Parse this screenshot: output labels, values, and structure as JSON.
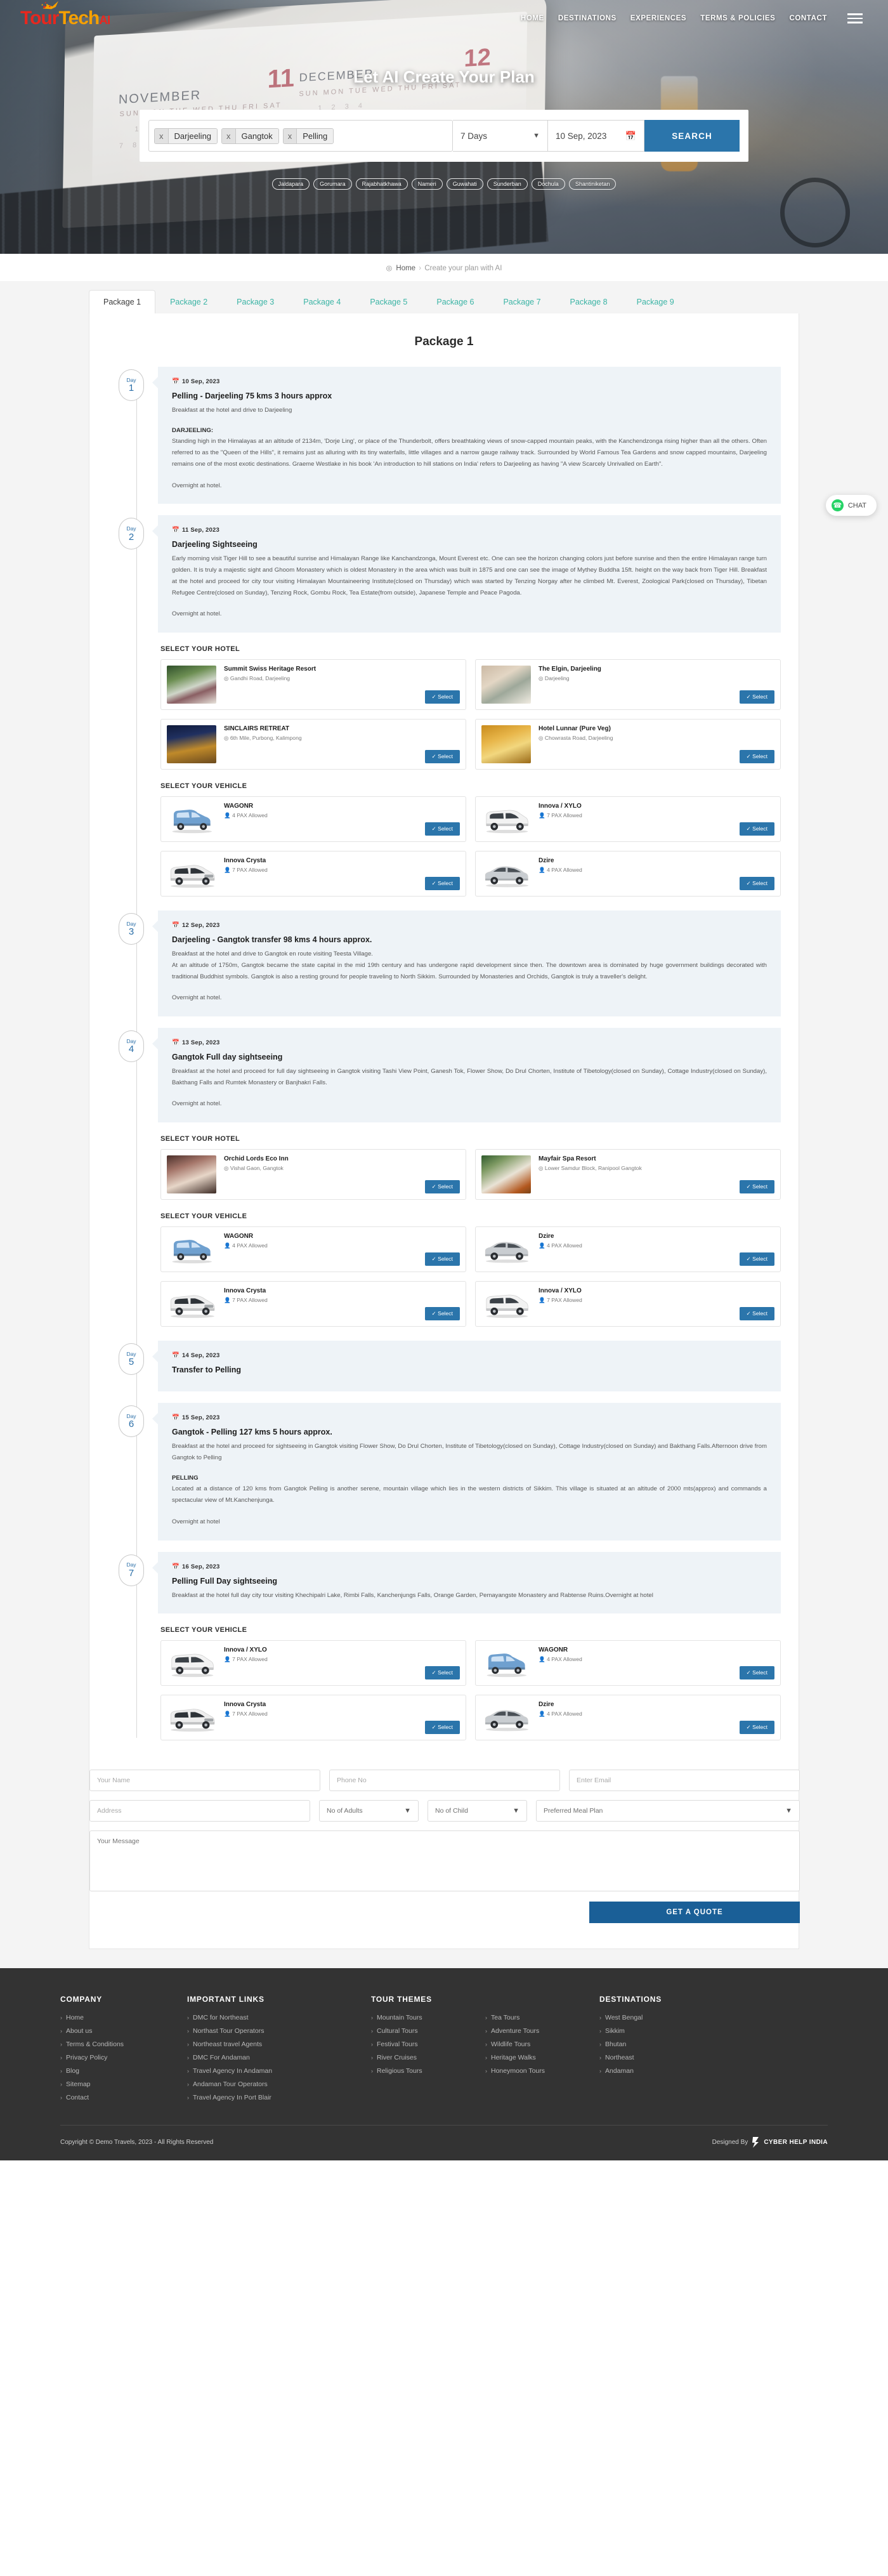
{
  "brand": {
    "name_part1": "T",
    "name_part2": "our",
    "name_part3": "Tech",
    "name_suffix": "AI"
  },
  "nav": {
    "items": [
      {
        "label": "HOME"
      },
      {
        "label": "DESTINATIONS"
      },
      {
        "label": "EXPERIENCES"
      },
      {
        "label": "TERMS & POLICIES"
      },
      {
        "label": "CONTACT"
      }
    ]
  },
  "hero": {
    "title": "Let AI Create Your Plan",
    "calendar": {
      "month_left": "NOVEMBER",
      "num_left": "11",
      "month_right": "DECEMBER",
      "num_right": "12"
    }
  },
  "search": {
    "destinations": [
      {
        "remove": "x",
        "label": "Darjeeling"
      },
      {
        "remove": "x",
        "label": "Gangtok"
      },
      {
        "remove": "x",
        "label": "Pelling"
      }
    ],
    "duration": "7 Days",
    "date": "10 Sep, 2023",
    "calendar_icon": "Ὄ5",
    "button": "SEARCH"
  },
  "tags": [
    "Jaldapara",
    "Gorumara",
    "Rajabhatkhawa",
    "Nameri",
    "Guwahati",
    "Sunderban",
    "Dochula",
    "Shantiniketan"
  ],
  "breadcrumb": {
    "home": "Home",
    "separator": "›",
    "current": "Create your plan with AI"
  },
  "tabs": [
    {
      "label": "Package 1",
      "active": true
    },
    {
      "label": "Package 2",
      "active": false
    },
    {
      "label": "Package 3",
      "active": false
    },
    {
      "label": "Package 4",
      "active": false
    },
    {
      "label": "Package 5",
      "active": false
    },
    {
      "label": "Package 6",
      "active": false
    },
    {
      "label": "Package 7",
      "active": false
    },
    {
      "label": "Package 8",
      "active": false
    },
    {
      "label": "Package 9",
      "active": false
    }
  ],
  "package_title": "Package 1",
  "section_labels": {
    "hotel": "SELECT YOUR HOTEL",
    "vehicle": "SELECT YOUR VEHICLE",
    "select": "Select",
    "check": "✓"
  },
  "days": [
    {
      "day_word": "Day",
      "day_num": "1",
      "date": "10 Sep, 2023",
      "heading": "Pelling - Darjeeling 75 kms 3 hours approx",
      "line1": "Breakfast at the hotel and drive to Darjeeling",
      "sub_heading": "DARJEELING:",
      "body": "Standing high in the Himalayas at an altitude of 2134m, 'Dorje Ling', or place of the Thunderbolt, offers breathtaking views of snow-capped mountain peaks, with the Kanchendzonga rising higher than all the others. Often referred to as the \"Queen of the Hills\", it remains just as alluring with its tiny waterfalls, little villages and a narrow gauge railway track. Surrounded by World Famous Tea Gardens and snow capped mountains, Darjeeling remains one of the most exotic destinations. Graeme Westlake in his book 'An introduction to hill stations on India' refers to Darjeeling as having \"A view Scarcely Unrivalled on Earth\".",
      "footer_line": "Overnight at hotel.",
      "hotels": [],
      "vehicles": []
    },
    {
      "day_word": "Day",
      "day_num": "2",
      "date": "11 Sep, 2023",
      "heading": "Darjeeling Sightseeing",
      "line1": "",
      "sub_heading": "",
      "body": "Early morning visit Tiger Hill to see a beautiful sunrise and Himalayan Range like Kanchandzonga, Mount Everest etc. One can see the horizon changing colors just before sunrise and then the entire Himalayan range turn golden. It is truly a majestic sight and Ghoom Monastery which is oldest Monastery in the area which was built in 1875 and one can see the image of Mythey Buddha 15ft. height on the way back from Tiger Hill. Breakfast at the hotel and proceed for city tour visiting Himalayan Mountaineering Institute(closed on Thursday) which was started by Tenzing Norgay after he climbed Mt. Everest, Zoological Park(closed on Thursday), Tibetan Refugee Centre(closed on Sunday), Tenzing Rock, Gombu Rock, Tea Estate(from outside), Japanese Temple and Peace Pagoda.",
      "footer_line": "Overnight at hotel.",
      "hotels": [
        {
          "name": "Summit Swiss Heritage Resort",
          "location": "Gandhi Road, Darjeeling",
          "thumb": "ph-summit"
        },
        {
          "name": "The Elgin, Darjeeling",
          "location": "Darjeeling",
          "thumb": "ph-elgin"
        },
        {
          "name": "SINCLAIRS RETREAT",
          "location": "6th Mile, Purbong, Kalimpong",
          "thumb": "ph-sinclairs"
        },
        {
          "name": "Hotel Lunnar (Pure Veg)",
          "location": "Chowrasta Road, Darjeeling",
          "thumb": "ph-lunnar"
        }
      ],
      "vehicles": [
        {
          "name": "WAGONR",
          "pax": "4 PAX Allowed",
          "color": "#6fa0cf"
        },
        {
          "name": "Innova / XYLO",
          "pax": "7 PAX Allowed",
          "color": "#f2f2f2"
        },
        {
          "name": "Innova Crysta",
          "pax": "7 PAX Allowed",
          "color": "#ededed"
        },
        {
          "name": "Dzire",
          "pax": "4 PAX Allowed",
          "color": "#c9cdd1"
        }
      ]
    },
    {
      "day_word": "Day",
      "day_num": "3",
      "date": "12 Sep, 2023",
      "heading": "Darjeeling - Gangtok transfer 98 kms 4 hours approx.",
      "line1": "Breakfast at the hotel and drive to Gangtok en route visiting Teesta Village.",
      "sub_heading": "",
      "body": "At an altitude of 1750m, Gangtok became the state capital in the mid 19th century and has undergone rapid development since then. The downtown area is dominated by huge government buildings decorated with traditional Buddhist symbols. Gangtok is also a resting ground for people traveling to North Sikkim. Surrounded by Monasteries and Orchids, Gangtok is truly a traveller's delight.",
      "footer_line": "Overnight at hotel.",
      "hotels": [],
      "vehicles": []
    },
    {
      "day_word": "Day",
      "day_num": "4",
      "date": "13 Sep, 2023",
      "heading": "Gangtok Full day sightseeing",
      "line1": "",
      "sub_heading": "",
      "body": "Breakfast at the hotel and proceed for full day sightseeing in Gangtok visiting Tashi View Point, Ganesh Tok, Flower Show, Do Drul Chorten, Institute of Tibetology(closed on Sunday), Cottage Industry(closed on Sunday), Bakthang Falls and Rumtek Monastery or Banjhakri Falls.",
      "footer_line": "Overnight at hotel.",
      "hotels": [
        {
          "name": "Orchid Lords Eco Inn",
          "location": "Vishal Gaon, Gangtok",
          "thumb": "ph-orchid"
        },
        {
          "name": "Mayfair Spa Resort",
          "location": "Lower Samdur Block, Ranipool Gangtok",
          "thumb": "ph-mayfair"
        }
      ],
      "vehicles": [
        {
          "name": "WAGONR",
          "pax": "4 PAX Allowed",
          "color": "#6fa0cf"
        },
        {
          "name": "Dzire",
          "pax": "4 PAX Allowed",
          "color": "#c9cdd1"
        },
        {
          "name": "Innova Crysta",
          "pax": "7 PAX Allowed",
          "color": "#ededed"
        },
        {
          "name": "Innova / XYLO",
          "pax": "7 PAX Allowed",
          "color": "#f2f2f2"
        }
      ]
    },
    {
      "day_word": "Day",
      "day_num": "5",
      "date": "14 Sep, 2023",
      "heading": "Transfer to Pelling",
      "line1": "",
      "sub_heading": "",
      "body": "",
      "footer_line": "",
      "hotels": [],
      "vehicles": []
    },
    {
      "day_word": "Day",
      "day_num": "6",
      "date": "15 Sep, 2023",
      "heading": "Gangtok - Pelling 127 kms 5 hours approx.",
      "line1": "Breakfast at the hotel and proceed for sightseeing in Gangtok visiting Flower Show, Do Drul Chorten, Institute of Tibetology(closed on Sunday), Cottage Industry(closed on Sunday) and Bakthang Falls.Afternoon drive from Gangtok to Pelling",
      "sub_heading": "PELLING",
      "body": "Located at a distance of 120 kms from Gangtok Pelling is another serene, mountain village which lies in the western districts of Sikkim. This village is situated at an altitude of 2000 mts(approx) and commands a spectacular view of Mt.Kanchenjunga.",
      "footer_line": "Overnight at hotel",
      "hotels": [],
      "vehicles": []
    },
    {
      "day_word": "Day",
      "day_num": "7",
      "date": "16 Sep, 2023",
      "heading": "Pelling Full Day sightseeing",
      "line1": "",
      "sub_heading": "",
      "body": "Breakfast at the hotel full day city tour visiting Khechipalri Lake, Rimbi Falls, Kanchenjungs Falls, Orange Garden, Pemayangste Monastery and Rabtense Ruins.Overnight at hotel",
      "footer_line": "",
      "hotels": [],
      "vehicles": [
        {
          "name": "Innova / XYLO",
          "pax": "7 PAX Allowed",
          "color": "#f2f2f2"
        },
        {
          "name": "WAGONR",
          "pax": "4 PAX Allowed",
          "color": "#6fa0cf"
        },
        {
          "name": "Innova Crysta",
          "pax": "7 PAX Allowed",
          "color": "#ededed"
        },
        {
          "name": "Dzire",
          "pax": "4 PAX Allowed",
          "color": "#c9cdd1"
        }
      ]
    }
  ],
  "form": {
    "name_placeholder": "Your Name",
    "phone_placeholder": "Phone No",
    "email_placeholder": "Enter Email",
    "address_placeholder": "Address",
    "adults": "No of Adults",
    "child": "No of Child",
    "meal": "Preferred Meal Plan",
    "message_placeholder": "Your Message",
    "submit": "GET A QUOTE"
  },
  "chat": {
    "label": "CHAT",
    "icon": "whatsapp-icon"
  },
  "footer": {
    "columns": [
      {
        "title": "COMPANY",
        "links": [
          "Home",
          "About us",
          "Terms & Conditions",
          "Privacy Policy",
          "Blog",
          "Sitemap",
          "Contact"
        ]
      },
      {
        "title": "IMPORTANT LINKS",
        "links": [
          "DMC for Northeast",
          "Northast Tour Operators",
          "Northeast travel Agents",
          "DMC For Andaman",
          "Travel Agency In Andaman",
          "Andaman Tour Operators",
          "Travel Agency In Port Blair"
        ]
      },
      {
        "title": "TOUR THEMES",
        "links_a": [
          "Mountain Tours",
          "Cultural Tours",
          "Festival Tours",
          "River Cruises",
          "Religious Tours"
        ],
        "links_b": [
          "Tea Tours",
          "Adventure Tours",
          "Wildlife Tours",
          "Heritage Walks",
          "Honeymoon Tours"
        ]
      },
      {
        "title": "DESTINATIONS",
        "links": [
          "West Bengal",
          "Sikkim",
          "Bhutan",
          "Northeast",
          "Andaman"
        ]
      }
    ],
    "copyright": "Copyright © Demo Travels, 2023 - All Rights Reserved",
    "designed_by": "Designed By",
    "designer": "CYBER HELP INDIA"
  },
  "colors": {
    "accent_blue": "#2b75ab",
    "teal": "#3bb4a5",
    "dark_blue": "#1a5f97",
    "footer_bg": "#333333",
    "card_bg": "#eef3f7"
  }
}
